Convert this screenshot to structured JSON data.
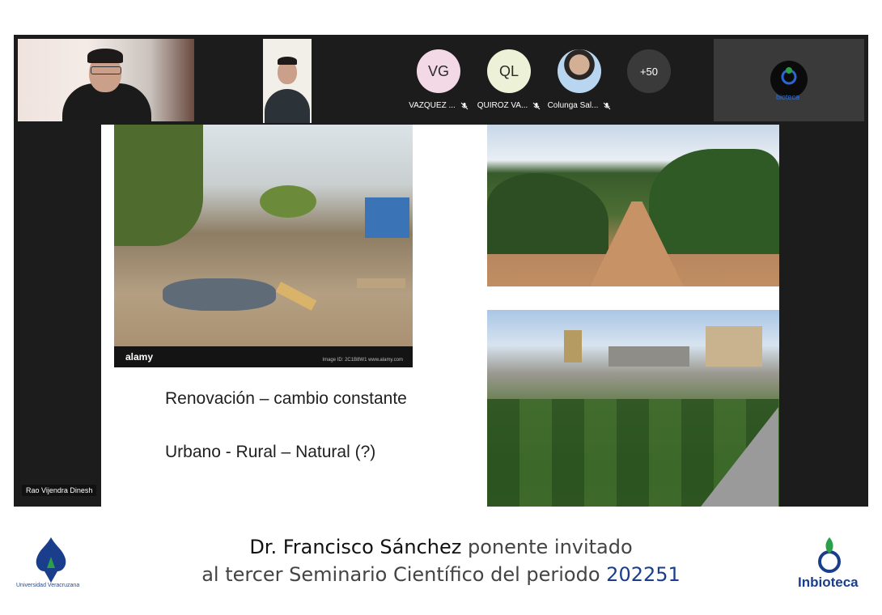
{
  "participants": {
    "tiles": [
      {
        "initials": "VG",
        "name": "VAZQUEZ ...",
        "color": "#f3d8e6"
      },
      {
        "initials": "QL",
        "name": "QUIROZ VA...",
        "color": "#ecf1d7"
      },
      {
        "initials": "",
        "name": "Colunga Sal..."
      }
    ],
    "more_count": "+50",
    "active_speaker": "Rao Vijendra Dinesh",
    "inbio_mini_label": "bioteca"
  },
  "slide": {
    "alamy": "alamy",
    "alamy_id": "Image ID: 2C1B8W1 www.alamy.com",
    "line1": "Renovación – cambio constante",
    "line2": "Urbano - Rural – Natural (?)"
  },
  "footer": {
    "line1_bold": "Dr. Francisco Sánchez",
    "line1_rest": " ponente invitado",
    "line2_pre": "al tercer Seminario Científico del periodo ",
    "line2_period": "202251",
    "uv_label": "Universidad Veracruzana",
    "inbio_label": "Inbioteca"
  },
  "colors": {
    "uv_blue": "#1a3e8c",
    "inbio_blue": "#1a3e8c",
    "inbio_green": "#2aa04a"
  }
}
